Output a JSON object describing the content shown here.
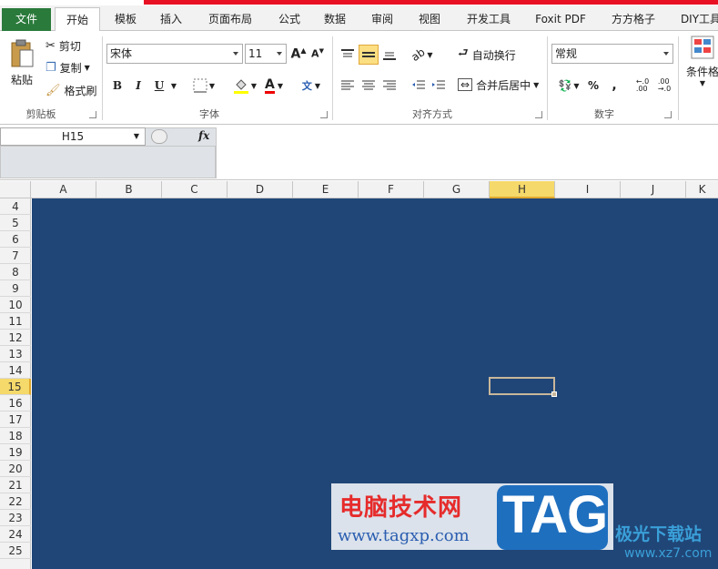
{
  "tabs": {
    "file": "文件",
    "items": [
      "开始",
      "模板",
      "插入",
      "页面布局",
      "公式",
      "数据",
      "审阅",
      "视图",
      "开发工具",
      "Foxit PDF",
      "方方格子",
      "DIY工具"
    ]
  },
  "clipboard": {
    "paste": "粘贴",
    "cut": "剪切",
    "copy": "复制",
    "format_painter": "格式刷",
    "label": "剪贴板"
  },
  "font": {
    "name": "宋体",
    "size": "11",
    "bold": "B",
    "italic": "I",
    "underline": "U",
    "label": "字体"
  },
  "alignment": {
    "wrap_text": "自动换行",
    "merge_center": "合并后居中",
    "label": "对齐方式"
  },
  "number": {
    "format": "常规",
    "percent": "%",
    "comma": ",",
    "inc_decimal": ".0 .00",
    "label": "数字"
  },
  "styles": {
    "conditional": "条件格"
  },
  "formula_bar": {
    "cell_ref": "H15",
    "fx": "fx"
  },
  "columns": [
    "A",
    "B",
    "C",
    "D",
    "E",
    "F",
    "G",
    "H",
    "I",
    "J",
    "K"
  ],
  "selected_column": "H",
  "rows": [
    "4",
    "5",
    "6",
    "7",
    "8",
    "9",
    "10",
    "11",
    "12",
    "13",
    "14",
    "15",
    "16",
    "17",
    "18",
    "19",
    "20",
    "21",
    "22",
    "23",
    "24",
    "25"
  ],
  "selected_row": "15",
  "colors": {
    "grid_fill": "#204677",
    "file_tab": "#2a7a3b",
    "header_selected": "#f5d96a"
  },
  "watermark": {
    "cn": "电脑技术网",
    "url": "www.tagxp.com",
    "tag": "TAG",
    "xz_cn": "极光下载站",
    "xz_url": "www.xz7.com"
  }
}
